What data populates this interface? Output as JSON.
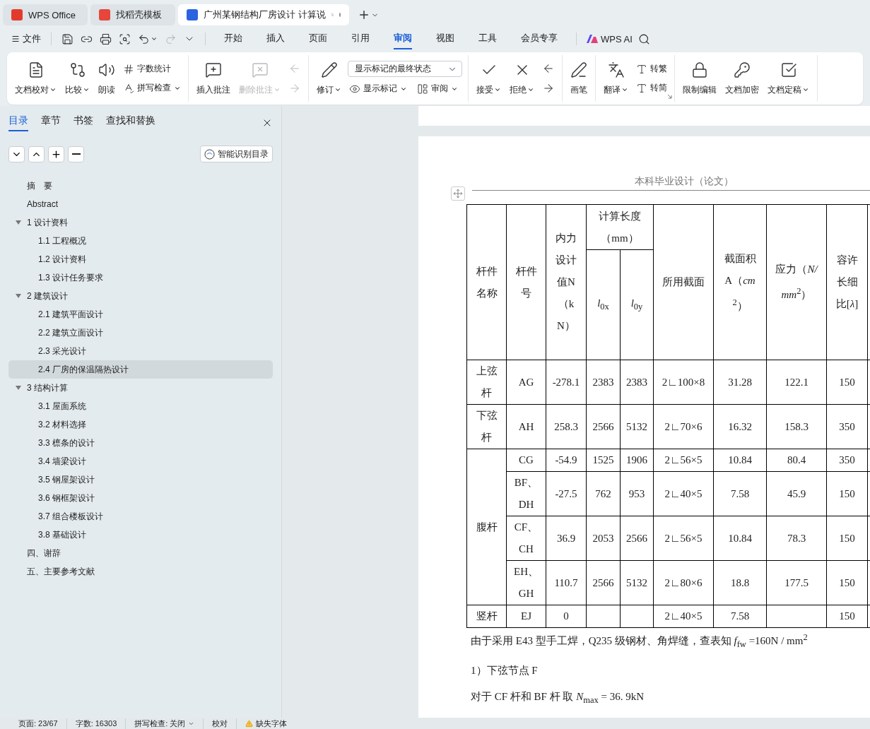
{
  "window_tabs": [
    {
      "kind": "home",
      "label": "WPS Office",
      "selected": false
    },
    {
      "kind": "template",
      "label": "找稻壳模板",
      "selected": false
    },
    {
      "kind": "doc",
      "label": "广州某钢结构厂房设计 计算说",
      "selected": true
    }
  ],
  "menu": {
    "file_label": "文件",
    "quick": [
      {
        "kind": "icon",
        "dropdown": false,
        "disabled": false
      },
      {
        "kind": "icon",
        "dropdown": false,
        "disabled": false
      },
      {
        "kind": "icon",
        "dropdown": false,
        "disabled": false
      },
      {
        "kind": "icon",
        "dropdown": false,
        "disabled": false
      },
      {
        "kind": "icon",
        "dropdown": true,
        "disabled": false
      },
      {
        "kind": "icon",
        "dropdown": false,
        "disabled": true
      },
      {
        "kind": "caret",
        "dropdown": false,
        "disabled": false
      }
    ],
    "tabs": [
      {
        "label": "开始",
        "selected": false
      },
      {
        "label": "插入",
        "selected": false
      },
      {
        "label": "页面",
        "selected": false
      },
      {
        "label": "引用",
        "selected": false
      },
      {
        "label": "审阅",
        "selected": true
      },
      {
        "label": "视图",
        "selected": false
      },
      {
        "label": "工具",
        "selected": false
      },
      {
        "label": "会员专享",
        "selected": false
      }
    ],
    "ai_label": "WPS AI"
  },
  "ribbon": [
    {
      "launcher": false,
      "items": [
        {
          "kind": "large",
          "label": "文档校对",
          "dropdown": true,
          "disabled": false
        },
        {
          "kind": "large",
          "label": "比较",
          "dropdown": true,
          "disabled": false
        },
        {
          "kind": "large",
          "label": "朗读",
          "dropdown": false,
          "disabled": false
        },
        {
          "kind": "stack",
          "items": [
            {
              "kind": "small",
              "label": "字数统计",
              "dropdown": false,
              "disabled": false
            },
            {
              "kind": "small",
              "label": "拼写检查",
              "dropdown": true,
              "disabled": false
            }
          ]
        }
      ]
    },
    {
      "launcher": false,
      "items": [
        {
          "kind": "large",
          "label": "插入批注",
          "dropdown": false,
          "disabled": false
        },
        {
          "kind": "large",
          "label": "删除批注",
          "dropdown": true,
          "disabled": true
        },
        {
          "kind": "stack",
          "items": [
            {
              "kind": "icon",
              "dropdown": false,
              "disabled": true
            },
            {
              "kind": "icon",
              "dropdown": false,
              "disabled": true
            }
          ]
        }
      ]
    },
    {
      "launcher": false,
      "items": [
        {
          "kind": "large",
          "label": "修订",
          "dropdown": true,
          "disabled": false
        },
        {
          "kind": "stack",
          "items": [
            {
              "kind": "select",
              "value": "显示标记的最终状态"
            },
            {
              "kind": "row",
              "items": [
                {
                  "kind": "small",
                  "label": "显示标记",
                  "dropdown": true,
                  "disabled": false
                },
                {
                  "kind": "small",
                  "label": "审阅",
                  "dropdown": true,
                  "disabled": false
                }
              ]
            }
          ]
        }
      ]
    },
    {
      "launcher": false,
      "items": [
        {
          "kind": "large",
          "label": "接受",
          "dropdown": true,
          "disabled": false
        },
        {
          "kind": "large",
          "label": "拒绝",
          "dropdown": true,
          "disabled": false
        },
        {
          "kind": "stack",
          "items": [
            {
              "kind": "icon",
              "dropdown": false,
              "disabled": false
            },
            {
              "kind": "icon",
              "dropdown": false,
              "disabled": false
            }
          ]
        }
      ]
    },
    {
      "launcher": false,
      "items": [
        {
          "kind": "large",
          "label": "画笔",
          "dropdown": false,
          "disabled": false
        }
      ]
    },
    {
      "launcher": true,
      "items": [
        {
          "kind": "large",
          "label": "翻译",
          "dropdown": true,
          "disabled": false
        },
        {
          "kind": "stack",
          "items": [
            {
              "kind": "small",
              "label": "转繁",
              "dropdown": false,
              "disabled": false
            },
            {
              "kind": "small",
              "label": "转简",
              "dropdown": false,
              "disabled": false
            }
          ]
        }
      ]
    },
    {
      "launcher": false,
      "items": [
        {
          "kind": "large",
          "label": "限制编辑",
          "dropdown": false,
          "disabled": false
        },
        {
          "kind": "large",
          "label": "文档加密",
          "dropdown": false,
          "disabled": false
        },
        {
          "kind": "large",
          "label": "文档定稿",
          "dropdown": true,
          "disabled": false
        }
      ]
    }
  ],
  "sidebar": {
    "tabs": [
      {
        "label": "目录",
        "selected": true
      },
      {
        "label": "章节",
        "selected": false
      },
      {
        "label": "书签",
        "selected": false
      },
      {
        "label": "查找和替换",
        "selected": false
      }
    ],
    "smart_button": "智能识别目录",
    "toc": [
      {
        "label": "摘　要",
        "selected": false
      },
      {
        "label": "Abstract",
        "selected": false
      },
      {
        "label": "1 设计资料",
        "selected": false,
        "expanded": true,
        "children": [
          {
            "label": "1.1 工程概况",
            "selected": false
          },
          {
            "label": "1.2 设计资料",
            "selected": false
          },
          {
            "label": "1.3 设计任务要求",
            "selected": false
          }
        ]
      },
      {
        "label": "2 建筑设计",
        "selected": false,
        "expanded": true,
        "children": [
          {
            "label": "2.1 建筑平面设计",
            "selected": false
          },
          {
            "label": "2.2 建筑立面设计",
            "selected": false
          },
          {
            "label": "2.3  采光设计",
            "selected": false
          },
          {
            "label": "2.4  厂房的保温隔热设计",
            "selected": true
          }
        ]
      },
      {
        "label": "3 结构计算",
        "selected": false,
        "expanded": true,
        "children": [
          {
            "label": "3.1 屋面系统",
            "selected": false
          },
          {
            "label": "3.2 材料选择",
            "selected": false
          },
          {
            "label": "3.3 檩条的设计",
            "selected": false
          },
          {
            "label": "3.4  墙梁设计",
            "selected": false
          },
          {
            "label": "3.5  钢屋架设计",
            "selected": false
          },
          {
            "label": "3.6 钢框架设计",
            "selected": false
          },
          {
            "label": "3.7 组合楼板设计",
            "selected": false
          },
          {
            "label": "3.8 基础设计",
            "selected": false
          }
        ]
      },
      {
        "label": "四、谢辞",
        "selected": false
      },
      {
        "label": "五、主要参考文献",
        "selected": false
      }
    ]
  },
  "document": {
    "page_header": "本科毕业设计（论文）",
    "table": {
      "group_label": "计算长度（mm）",
      "columns": [
        {
          "label": "杆件名称",
          "grouped": false
        },
        {
          "label": "杆件号",
          "grouped": false
        },
        {
          "label": "内力设计值N（kN）",
          "grouped": false
        },
        {
          "label": "*l*$_{0x}$",
          "grouped": true
        },
        {
          "label": "*l*$_{0y}$",
          "grouped": true
        },
        {
          "label": "所用截面",
          "grouped": false
        },
        {
          "label": "截面积A（*cm*$^{2}$）",
          "grouped": false
        },
        {
          "label": "应力（*N/mm*$^{2}$）",
          "grouped": false
        },
        {
          "label": "容许长细比[*λ*]",
          "grouped": false
        }
      ],
      "groups": [
        {
          "name": "上弦杆",
          "rows": [
            [
              "AG",
              "-278.1",
              "2383",
              "2383",
              "2∟100×8",
              "31.28",
              "122.1",
              "150"
            ]
          ]
        },
        {
          "name": "下弦杆",
          "rows": [
            [
              "AH",
              "258.3",
              "2566",
              "5132",
              "2∟70×6",
              "16.32",
              "158.3",
              "350"
            ]
          ]
        },
        {
          "name": "腹杆",
          "rows": [
            [
              "CG",
              "-54.9",
              "1525",
              "1906",
              "2∟56×5",
              "10.84",
              "80.4",
              "350"
            ],
            [
              "BF、DH",
              "-27.5",
              "762",
              "953",
              "2∟40×5",
              "7.58",
              "45.9",
              "150"
            ],
            [
              "CF、CH",
              "36.9",
              "2053",
              "2566",
              "2∟56×5",
              "10.84",
              "78.3",
              "150"
            ],
            [
              "EH、GH",
              "110.7",
              "2566",
              "5132",
              "2∟80×6",
              "18.8",
              "177.5",
              "150"
            ]
          ]
        },
        {
          "name": "竖杆",
          "rows": [
            [
              "EJ",
              "0",
              "",
              "",
              "2∟40×5",
              "7.58",
              "",
              "150"
            ]
          ]
        }
      ]
    },
    "paragraphs": [
      "由于采用 E43 型手工焊，Q235 级钢材、角焊缝，查表知  *f*$_{fw}$ =160N / mm$^{2}$",
      "1）下弦节点 F",
      "对于 CF 杆和 BF 杆  取 *N*$_{max}$ = 36. 9kN"
    ]
  },
  "status_bar": [
    {
      "kind": "text",
      "label": "页面: 23/67"
    },
    {
      "kind": "text",
      "label": "字数: 16303"
    },
    {
      "kind": "dropdown",
      "label": "拼写检查: 关闭"
    },
    {
      "kind": "text",
      "label": "校对"
    },
    {
      "kind": "warning",
      "label": "缺失字体"
    }
  ]
}
